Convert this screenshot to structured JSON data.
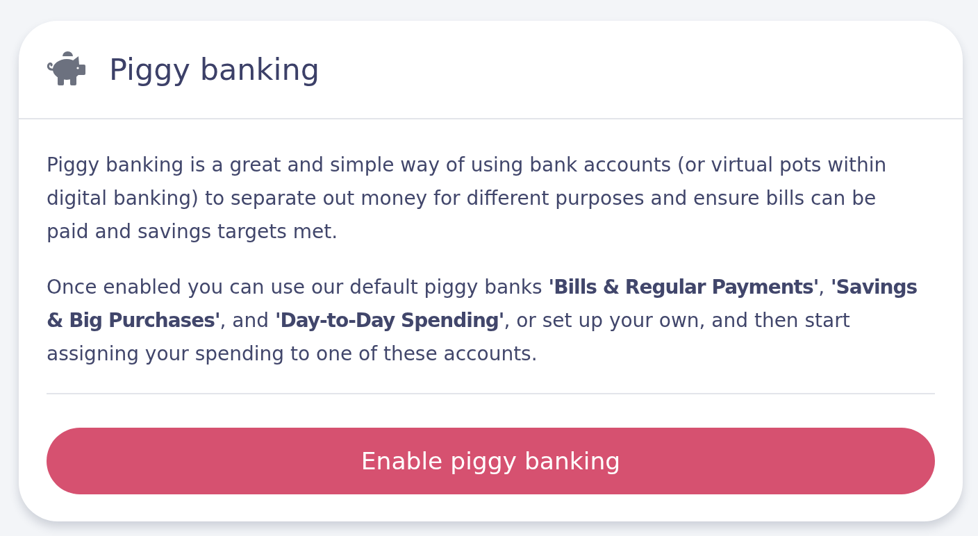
{
  "card": {
    "header": {
      "title": "Piggy banking"
    },
    "paragraphs": [
      "Piggy banking is a great and simple way of using bank accounts (or virtual pots within digital banking) to separate out money for different purposes and ensure bills can be paid and savings targets met.",
      "Once enabled you can use our default piggy banks **'Bills & Regular Payments'**, **'Savings & Big Purchases'**, and **'Day-to-Day Spending'**, or set up your own, and then start assigning your spending to one of these accounts."
    ],
    "button": {
      "label": "Enable piggy banking"
    }
  }
}
